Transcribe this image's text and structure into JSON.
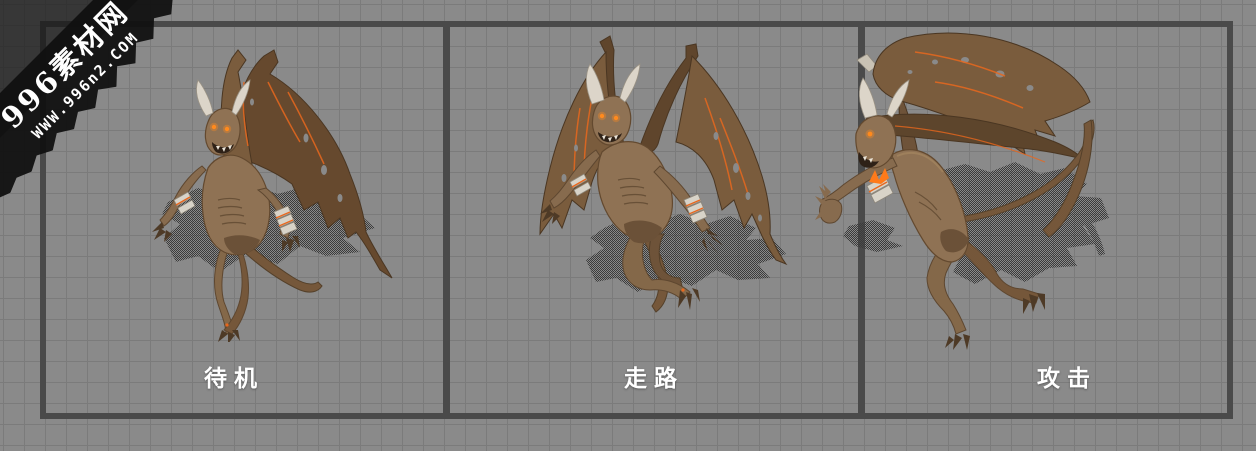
{
  "page": {
    "background_color": "#8a8a8a",
    "grid_line_color": "#7b7b7b",
    "frame_color": "#4a4a4a",
    "label_color": "#ffffff"
  },
  "watermark": {
    "site_name": "996素材网",
    "site_url": "WWW.996n2.COM",
    "ribbon_color": "#161616",
    "text_color": "#ffffff"
  },
  "model": {
    "subject": "winged-demon-character",
    "body_color": "#8f7254",
    "wing_color": "#7a5c3d",
    "wing_dark_color": "#5f452c",
    "horn_color": "#dcd5c9",
    "eye_color": "#ff8a1e",
    "lava_accent_color": "#e8671d",
    "wristband_color": "#d8d3c8",
    "shadow_color": "#3b3b3b"
  },
  "panels": [
    {
      "id": "idle",
      "label": "待机",
      "render": "demon-idle-pose"
    },
    {
      "id": "walk",
      "label": "走路",
      "render": "demon-walk-pose"
    },
    {
      "id": "attack",
      "label": "攻击",
      "render": "demon-attack-pose"
    }
  ]
}
